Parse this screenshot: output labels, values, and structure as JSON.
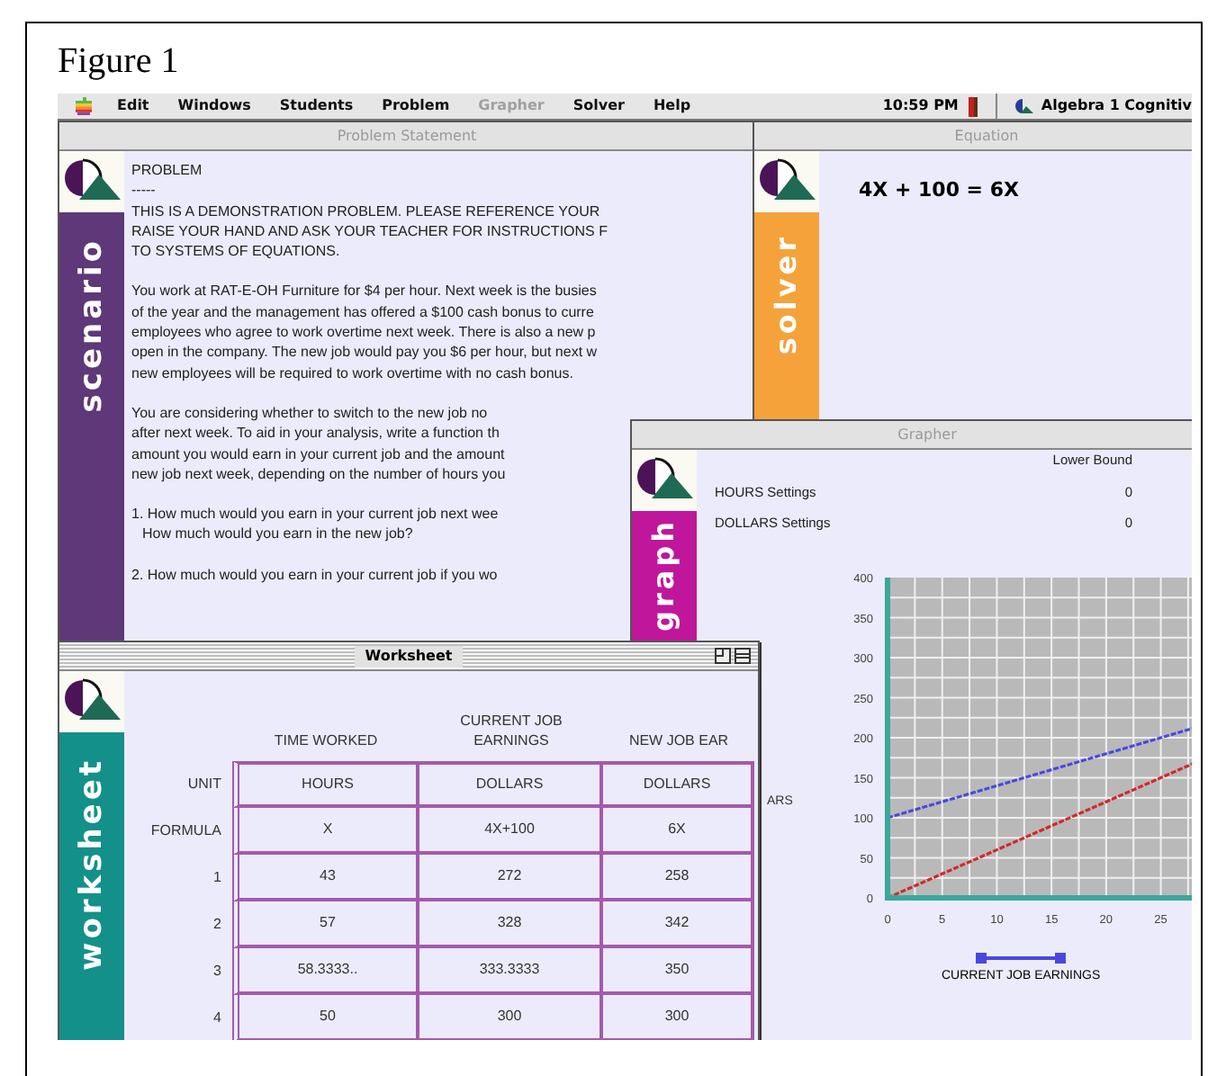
{
  "caption": "Figure 1",
  "menu_bar": {
    "items": [
      {
        "label": "Edit",
        "disabled": false
      },
      {
        "label": "Windows",
        "disabled": false
      },
      {
        "label": "Students",
        "disabled": false
      },
      {
        "label": "Problem",
        "disabled": false
      },
      {
        "label": "Grapher",
        "disabled": true
      },
      {
        "label": "Solver",
        "disabled": false
      },
      {
        "label": "Help",
        "disabled": false
      }
    ],
    "clock": "10:59 PM",
    "app_name": "Algebra 1 Cognitiv"
  },
  "problem_window": {
    "title": "Problem Statement",
    "active": false,
    "band_label": "scenario",
    "heading": "PROBLEM",
    "rule": "-----",
    "paragraphs": [
      {
        "kind": "body",
        "lines": [
          "THIS IS A DEMONSTRATION PROBLEM.  PLEASE REFERENCE YOUR",
          "RAISE YOUR HAND AND ASK YOUR TEACHER FOR INSTRUCTIONS F",
          "TO SYSTEMS OF EQUATIONS."
        ]
      },
      {
        "kind": "body",
        "lines": [
          "You work at RAT-E-OH Furniture for $4 per hour.   Next week is the busies",
          "of the year and the management has offered a $100 cash bonus to curre",
          "employees who agree to work overtime next week.  There is also a new p",
          "open in the company.  The new job would pay you $6 per hour, but next w",
          "new employees will be required to work overtime with no cash bonus."
        ]
      },
      {
        "kind": "body",
        "lines": [
          "You are considering whether to switch to the new job no",
          "after next week.  To aid in your analysis, write a function th",
          "amount you would earn in your current job and the amount",
          "new job next week, depending on the number of hours you"
        ]
      },
      {
        "kind": "question",
        "lines": [
          "1.   How much would you earn in your current job next wee",
          "How much would you earn in the new job?"
        ]
      },
      {
        "kind": "question",
        "lines": [
          "2.   How much would you earn in your current job if you wo"
        ]
      }
    ]
  },
  "equation_window": {
    "title": "Equation",
    "active": false,
    "band_label": "solver",
    "equation": "4X + 100 = 6X"
  },
  "grapher_window": {
    "title": "Grapher",
    "active": false,
    "band_label": "graph",
    "bound_header": "Lower Bound",
    "settings": [
      {
        "label": "HOURS Settings",
        "lower_bound": "0"
      },
      {
        "label": "DOLLARS Settings",
        "lower_bound": "0"
      }
    ],
    "chart_data": {
      "type": "line",
      "x": [
        0,
        5,
        10,
        15,
        20,
        25,
        28
      ],
      "series": [
        {
          "name": "CURRENT JOB EARNINGS",
          "color": "#4848e0",
          "line_style": "dashed",
          "values": [
            100,
            120,
            140,
            160,
            180,
            200,
            212
          ]
        },
        {
          "color": "#d42828",
          "line_style": "dashed",
          "values": [
            0,
            30,
            60,
            90,
            120,
            150,
            168
          ]
        }
      ],
      "grid": true,
      "annotations": [
        {
          "text": "ARS"
        }
      ],
      "xlim": [
        0,
        28
      ],
      "ylim": [
        0,
        400
      ],
      "xticks": [
        0,
        5,
        10,
        15,
        20,
        25
      ],
      "yticks": [
        0,
        50,
        100,
        150,
        200,
        250,
        300,
        350,
        400
      ]
    }
  },
  "worksheet_window": {
    "title": "Worksheet",
    "active": true,
    "band_label": "worksheet",
    "columns": [
      "TIME WORKED",
      "CURRENT JOB EARNINGS",
      "NEW JOB EAR"
    ],
    "rows": [
      {
        "label": "UNIT",
        "cells": [
          "HOURS",
          "DOLLARS",
          "DOLLARS"
        ]
      },
      {
        "label": "FORMULA",
        "cells": [
          "X",
          "4X+100",
          "6X"
        ]
      },
      {
        "label": "1",
        "cells": [
          "43",
          "272",
          "258"
        ]
      },
      {
        "label": "2",
        "cells": [
          "57",
          "328",
          "342"
        ]
      },
      {
        "label": "3",
        "cells": [
          "58.3333..",
          "333.3333",
          "350"
        ]
      },
      {
        "label": "4",
        "cells": [
          "50",
          "300",
          "300"
        ]
      }
    ]
  }
}
